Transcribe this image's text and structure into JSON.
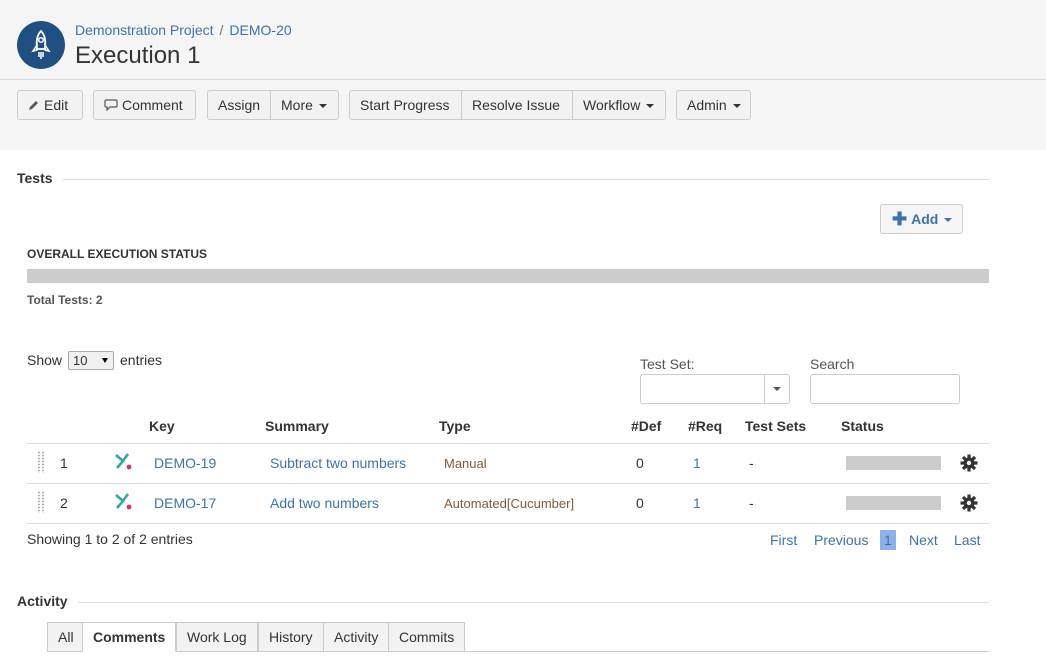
{
  "breadcrumb": {
    "project": "Demonstration Project",
    "sep": "/",
    "issue_key": "DEMO-20"
  },
  "page_title": "Execution 1",
  "toolbar": {
    "edit": "Edit",
    "comment": "Comment",
    "assign": "Assign",
    "more": "More",
    "start_progress": "Start Progress",
    "resolve_issue": "Resolve Issue",
    "workflow": "Workflow",
    "admin": "Admin"
  },
  "tests_section": {
    "title": "Tests",
    "add_label": "Add",
    "overall_label": "OVERALL EXECUTION STATUS",
    "total_tests": "Total Tests: 2",
    "show": "Show",
    "page_length": "10",
    "entries": "entries",
    "test_set_label": "Test Set:",
    "search_label": "Search",
    "columns": [
      "Key",
      "Summary",
      "Type",
      "#Def",
      "#Req",
      "Test Sets",
      "Status"
    ],
    "rows": [
      {
        "rank": "1",
        "key": "DEMO-19",
        "summary": "Subtract two numbers",
        "type": "Manual",
        "def": "0",
        "req": "1",
        "test_sets": "-"
      },
      {
        "rank": "2",
        "key": "DEMO-17",
        "summary": "Add two numbers",
        "type": "Automated[Cucumber]",
        "def": "0",
        "req": "1",
        "test_sets": "-"
      }
    ],
    "showing": "Showing 1 to 2 of 2 entries",
    "pager": {
      "first": "First",
      "previous": "Previous",
      "current": "1",
      "next": "Next",
      "last": "Last"
    }
  },
  "activity_section": {
    "title": "Activity",
    "tabs": [
      "All",
      "Comments",
      "Work Log",
      "History",
      "Activity",
      "Commits"
    ],
    "active_tab": "Comments"
  },
  "colors": {
    "link": "#3b73af",
    "avatar": "#205081",
    "header_bg": "#f5f5f5",
    "status_gray": "#cccccc"
  },
  "icons": [
    "rocket-icon",
    "pencil-icon",
    "speech-bubble-icon",
    "plus-icon",
    "xray-test-icon",
    "gear-icon",
    "drag-handle-icon"
  ]
}
